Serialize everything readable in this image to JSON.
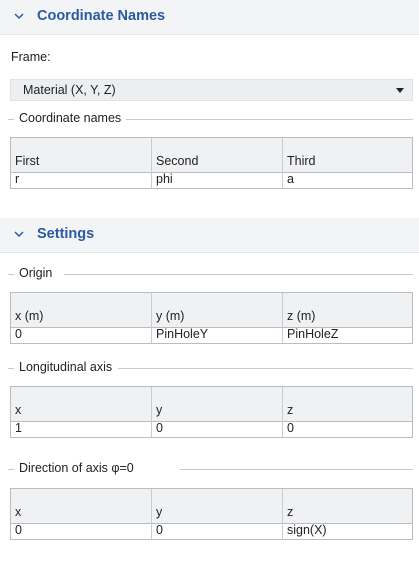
{
  "coordinate_names": {
    "section_title": "Coordinate Names",
    "frame_label": "Frame:",
    "frame_value": "Material  (X, Y, Z)",
    "group_title": "Coordinate names",
    "headers": [
      "First",
      "Second",
      "Third"
    ],
    "values": [
      "r",
      "phi",
      "a"
    ]
  },
  "settings": {
    "section_title": "Settings",
    "origin": {
      "group_title": "Origin",
      "headers": [
        "x (m)",
        "y (m)",
        "z (m)"
      ],
      "values": [
        "0",
        "PinHoleY",
        "PinHoleZ"
      ]
    },
    "longitudinal": {
      "group_title": "Longitudinal axis",
      "headers": [
        "x",
        "y",
        "z"
      ],
      "values": [
        "1",
        "0",
        "0"
      ]
    },
    "direction": {
      "group_title": "Direction of axis φ=0",
      "headers": [
        "x",
        "y",
        "z"
      ],
      "values": [
        "0",
        "0",
        "sign(X)"
      ]
    }
  },
  "colors": {
    "accent": "#2c5aa0",
    "header_bg": "#f3f4f6",
    "select_bg": "#eceef1",
    "grid_border": "#b9bcc1"
  },
  "icons": {
    "section_toggle": "chevron-down-icon",
    "select_arrow": "triangle-down-icon"
  }
}
